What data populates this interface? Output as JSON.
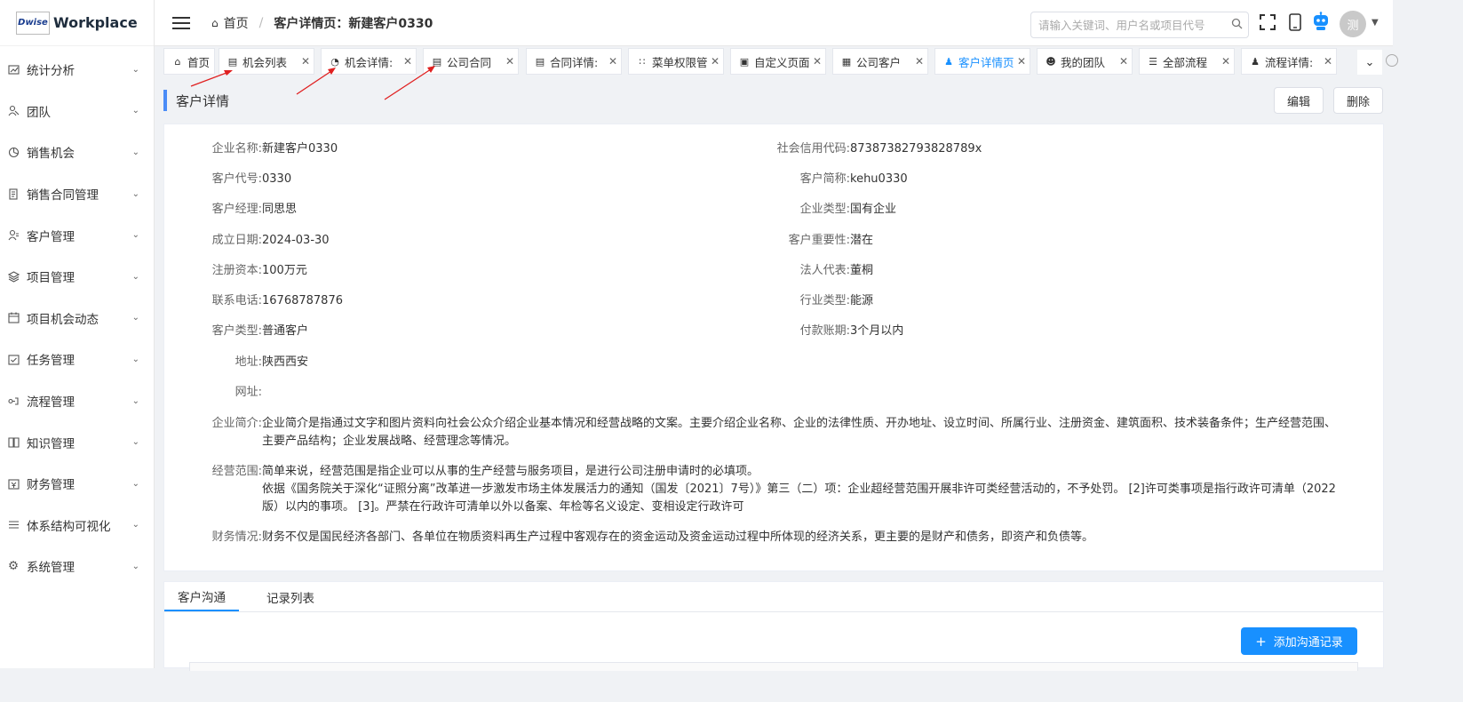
{
  "app": {
    "logo_small": "Dwise",
    "logo_text": "Workplace"
  },
  "sidebar": {
    "items": [
      {
        "label": "统计分析",
        "icon": "chart-icon"
      },
      {
        "label": "团队",
        "icon": "team-icon"
      },
      {
        "label": "销售机会",
        "icon": "pie-icon"
      },
      {
        "label": "销售合同管理",
        "icon": "contract-icon"
      },
      {
        "label": "客户管理",
        "icon": "customer-icon"
      },
      {
        "label": "项目管理",
        "icon": "layers-icon"
      },
      {
        "label": "项目机会动态",
        "icon": "calendar-icon"
      },
      {
        "label": "任务管理",
        "icon": "task-icon"
      },
      {
        "label": "流程管理",
        "icon": "flow-icon"
      },
      {
        "label": "知识管理",
        "icon": "book-icon"
      },
      {
        "label": "财务管理",
        "icon": "finance-icon"
      },
      {
        "label": "体系结构可视化",
        "icon": "list-icon"
      },
      {
        "label": "系统管理",
        "icon": "gear-icon"
      }
    ]
  },
  "header": {
    "breadcrumb_home": "首页",
    "breadcrumb_current": "客户详情页：新建客户0330",
    "search_placeholder": "请输入关键词、用户名或项目代号",
    "avatar_text": "测"
  },
  "tabs": [
    {
      "label": "首页",
      "icon": "home-icon",
      "closable": false
    },
    {
      "label": "机会列表",
      "icon": "doc-icon",
      "closable": true
    },
    {
      "label": "机会详情:",
      "icon": "pie-icon",
      "closable": true
    },
    {
      "label": "公司合同",
      "icon": "doc-icon",
      "closable": true
    },
    {
      "label": "合同详情:",
      "icon": "doc-icon",
      "closable": true
    },
    {
      "label": "菜单权限管理",
      "icon": "grid-icon",
      "closable": true
    },
    {
      "label": "自定义页面",
      "icon": "window-icon",
      "closable": true
    },
    {
      "label": "公司客户",
      "icon": "building-icon",
      "closable": true
    },
    {
      "label": "客户详情页",
      "icon": "customer-icon",
      "closable": true,
      "active": true
    },
    {
      "label": "我的团队",
      "icon": "team-icon",
      "closable": true
    },
    {
      "label": "全部流程",
      "icon": "list-icon",
      "closable": true
    },
    {
      "label": "流程详情:",
      "icon": "user-icon",
      "closable": true
    }
  ],
  "page": {
    "title": "客户详情",
    "edit_label": "编辑",
    "delete_label": "删除"
  },
  "detail": {
    "left": [
      {
        "label": "企业名称:",
        "value": "新建客户0330"
      },
      {
        "label": "客户代号:",
        "value": "0330"
      },
      {
        "label": "客户经理:",
        "value": "同思思"
      },
      {
        "label": "成立日期:",
        "value": "2024-03-30"
      },
      {
        "label": "注册资本:",
        "value": "100万元"
      },
      {
        "label": "联系电话:",
        "value": "16768787876"
      },
      {
        "label": "客户类型:",
        "value": "普通客户"
      },
      {
        "label": "地址:",
        "value": "陕西西安"
      },
      {
        "label": "网址:",
        "value": ""
      }
    ],
    "right": [
      {
        "label": "社会信用代码:",
        "value": "87387382793828789x"
      },
      {
        "label": "客户简称:",
        "value": "kehu0330"
      },
      {
        "label": "企业类型:",
        "value": "国有企业"
      },
      {
        "label": "客户重要性:",
        "value": "潜在"
      },
      {
        "label": "法人代表:",
        "value": "董桐"
      },
      {
        "label": "行业类型:",
        "value": "能源"
      },
      {
        "label": "付款账期:",
        "value": "3个月以内"
      }
    ],
    "intro_label": "企业简介:",
    "intro_line1": "企业简介是指通过文字和图片资料向社会公众介绍企业基本情况和经营战略的文案。主要介绍企业名称、企业的法律性质、开办地址、设立时间、所属行业、注册资金、建筑面积、技术装备条件；生产经营范围、",
    "intro_line2": "主要产品结构；企业发展战略、经营理念等情况。",
    "scope_label": "经营范围:",
    "scope_line1": "简单来说，经营范围是指企业可以从事的生产经营与服务项目，是进行公司注册申请时的必填项。",
    "scope_line2": "依据《国务院关于深化“证照分离”改革进一步激发市场主体发展活力的通知（国发〔2021〕7号）》第三（二）项：企业超经营范围开展非许可类经营活动的，不予处罚。 [2]许可类事项是指行政许可清单（2022",
    "scope_line3": "版）以内的事项。 [3]。严禁在行政许可清单以外以备案、年检等名义设定、变相设定行政许可",
    "finance_label": "财务情况:",
    "finance_line1": "财务不仅是国民经济各部门、各单位在物质资料再生产过程中客观存在的资金运动及资金运动过程中所体现的经济关系，更主要的是财产和债务，即资产和负债等。"
  },
  "bottom": {
    "tab_comm": "客户沟通",
    "tab_records": "记录列表",
    "add_label": "添加沟通记录"
  },
  "colors": {
    "accent": "#1890ff",
    "title_accent": "#4a8cf7",
    "arrow": "#e02020"
  }
}
